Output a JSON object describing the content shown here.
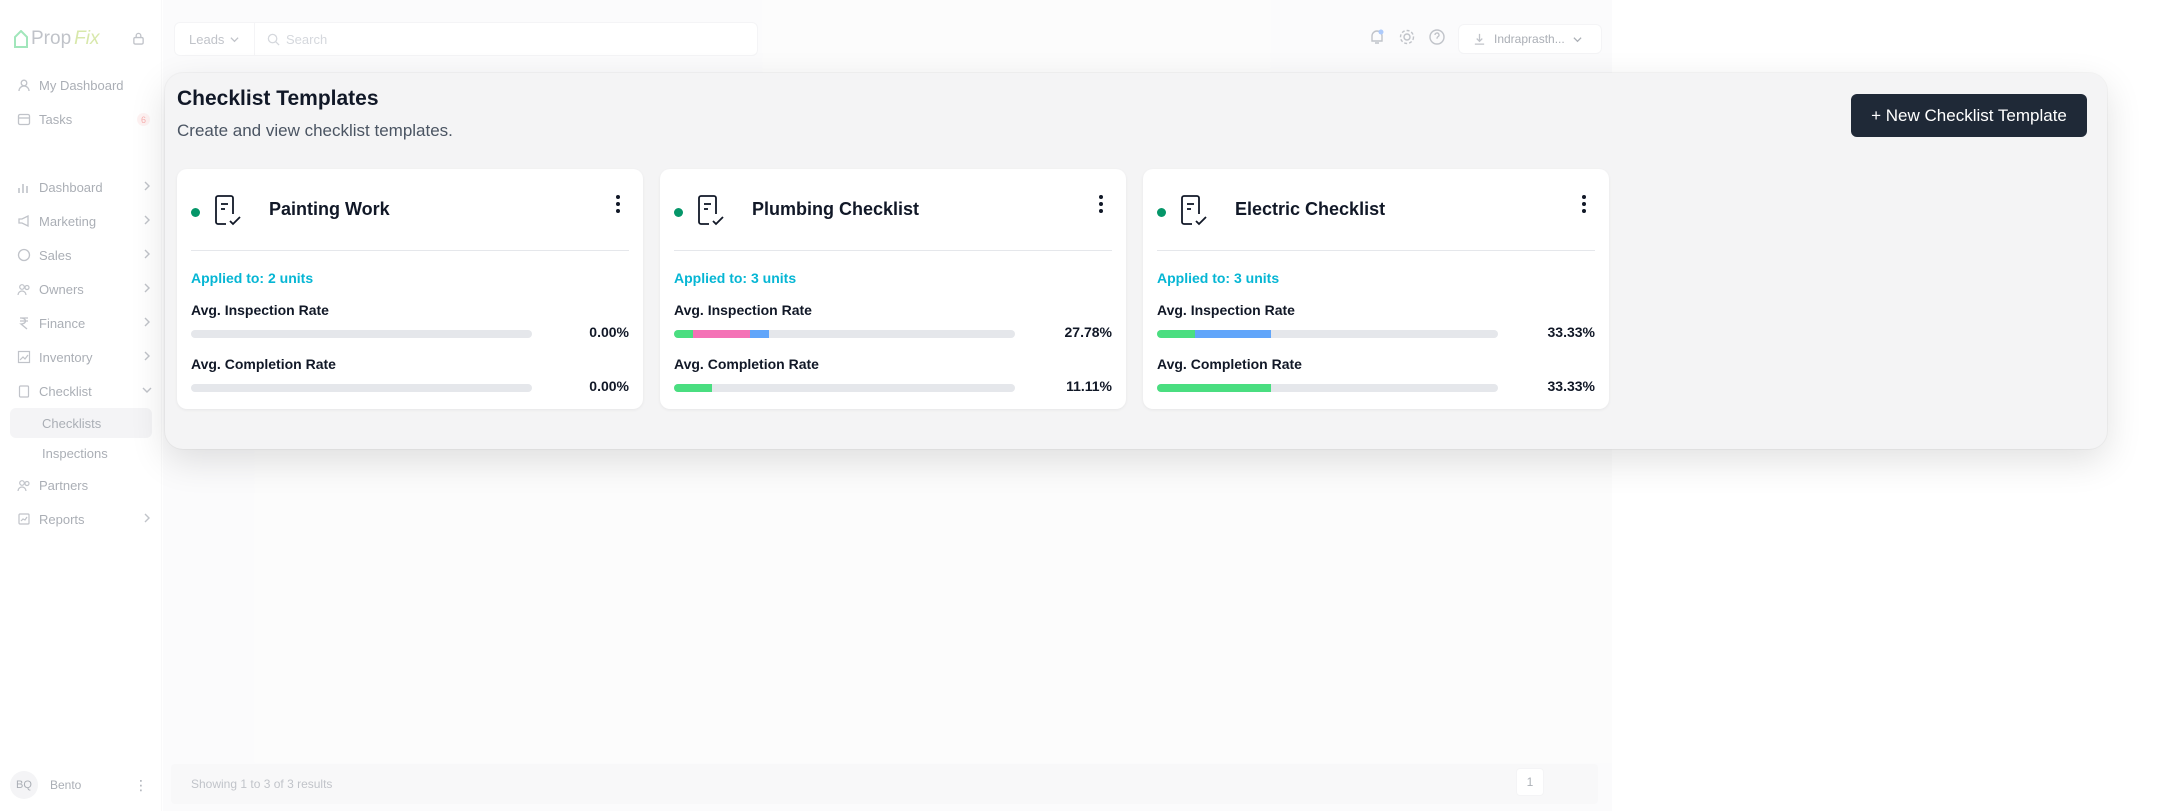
{
  "sidebar": {
    "logo_text": "Prop",
    "logo_accent": "Fix",
    "items": [
      {
        "label": "My Dashboard"
      },
      {
        "label": "Tasks",
        "badge": "6"
      },
      {
        "label": "Dashboard"
      },
      {
        "label": "Marketing"
      },
      {
        "label": "Sales"
      },
      {
        "label": "Owners"
      },
      {
        "label": "Finance"
      },
      {
        "label": "Inventory"
      },
      {
        "label": "Checklist"
      },
      {
        "label": "Partners"
      },
      {
        "label": "Reports"
      }
    ],
    "sub_items": [
      {
        "label": "Checklists"
      },
      {
        "label": "Inspections"
      }
    ],
    "user": {
      "initials": "BQ",
      "name": "Bento"
    }
  },
  "topbar": {
    "module": "Leads",
    "search_placeholder": "Search",
    "location": "Indraprasth..."
  },
  "footer": {
    "results": "Showing 1 to 3 of 3 results",
    "page": "1"
  },
  "modal": {
    "title": "Checklist Templates",
    "subtitle": "Create and view checklist templates.",
    "new_button": "+ New Checklist Template",
    "inspection_label": "Avg. Inspection Rate",
    "completion_label": "Avg. Completion Rate"
  },
  "colors": {
    "status_dot": "#059669",
    "applied": "#06b6d4",
    "seg_green": "#4ade80",
    "seg_pink": "#f472b6",
    "seg_blue": "#60a5fa"
  },
  "cards": [
    {
      "name": "Painting Work",
      "applied": "Applied to: 2 units",
      "inspection_pct": "0.00%",
      "completion_pct": "0.00%",
      "inspection_segments": [],
      "completion_segments": []
    },
    {
      "name": "Plumbing Checklist",
      "applied": "Applied to: 3 units",
      "inspection_pct": "27.78%",
      "completion_pct": "11.11%",
      "inspection_segments": [
        {
          "color": "#4ade80",
          "percent": 5.56
        },
        {
          "color": "#f472b6",
          "percent": 16.67
        },
        {
          "color": "#60a5fa",
          "percent": 5.56
        }
      ],
      "completion_segments": [
        {
          "color": "#4ade80",
          "percent": 11.11
        }
      ]
    },
    {
      "name": "Electric Checklist",
      "applied": "Applied to: 3 units",
      "inspection_pct": "33.33%",
      "completion_pct": "33.33%",
      "inspection_segments": [
        {
          "color": "#4ade80",
          "percent": 11.11
        },
        {
          "color": "#60a5fa",
          "percent": 22.22
        }
      ],
      "completion_segments": [
        {
          "color": "#4ade80",
          "percent": 33.33
        }
      ]
    }
  ]
}
